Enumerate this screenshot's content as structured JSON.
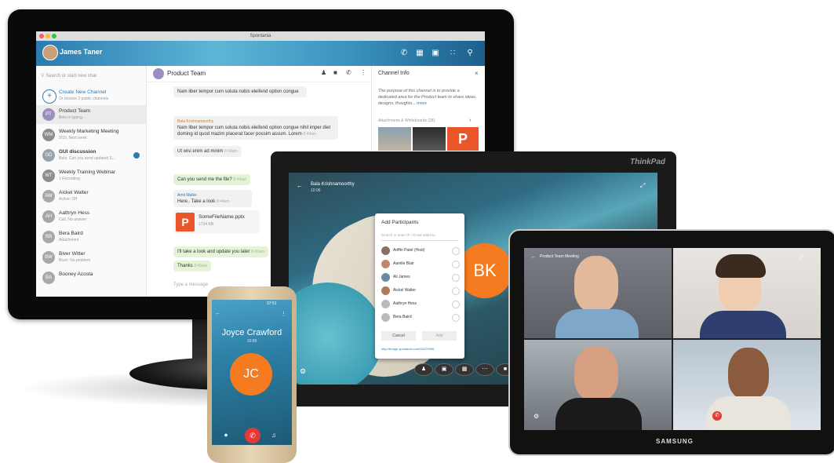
{
  "desktop": {
    "window_title": "Spontania",
    "user_name": "James Taner",
    "sidebar": {
      "search_placeholder": "Search or start new chat",
      "items": [
        {
          "title": "Create New Channel",
          "sub": "Or browse 2 public channels",
          "initials": "+"
        },
        {
          "title": "Product Team",
          "sub": "Bela is typing...",
          "initials": "PT"
        },
        {
          "title": "Weekly Marketing Meeting",
          "sub": "9/10, Next week",
          "initials": "WM"
        },
        {
          "title": "GUI discussion",
          "sub": "Bela: Can you send updated S...",
          "initials": "GD"
        },
        {
          "title": "Weekly Training Webinar",
          "sub": "1 Recording",
          "initials": "WT"
        },
        {
          "title": "Aickel Walter",
          "sub": "Active: Off",
          "initials": "AW"
        },
        {
          "title": "Aathryn Hess",
          "sub": "Call, No answer",
          "initials": "AH"
        },
        {
          "title": "Bera Baird",
          "sub": "Attachment",
          "initials": "BB"
        },
        {
          "title": "Biver Witter",
          "sub": "Biver: No problem",
          "initials": "BW"
        },
        {
          "title": "Booney Acosta",
          "sub": "",
          "initials": "BA"
        }
      ]
    },
    "chat": {
      "title": "Product Team",
      "messages": [
        {
          "sender": "",
          "text": "Nam liber tempor cum soluta nobis eleifend option congue",
          "time": ""
        },
        {
          "sender": "Bala Krishnamoorthy",
          "text": "Nam liber tempor cum soluta nobis eleifend option congue nihil imper diet doming id quod mazim placerat facer possim assum. Lorem",
          "time": "8:44am"
        },
        {
          "sender": "",
          "text": "Ut wisi enim ad minim",
          "time": "8:44am"
        },
        {
          "sender": "",
          "text": "Can you send me the file?",
          "time": "8:44am"
        },
        {
          "sender": "Amit Malke",
          "text": "Here.. Take a look",
          "time": "8:44am"
        },
        {
          "sender": "",
          "text": "I'll take a look and update you later",
          "time": "8:45am"
        },
        {
          "sender": "",
          "text": "Thanks",
          "time": "8:45am"
        }
      ],
      "file_name": "SomeFileName.pptx",
      "file_size": "1734 KB",
      "input_placeholder": "Type a message"
    },
    "channel_info": {
      "title": "Channel Info",
      "description": "The purpose of this channel is to provide a dedicated area for the Product team to share ideas, designs, thoughts...",
      "more": "more",
      "attachments_label": "Attachments & Whiteboards (28)"
    }
  },
  "thinkpad": {
    "brand": "ThinkPad",
    "caller": "Bala Krishnamoorthy",
    "duration": "10:06",
    "initials": "BK",
    "dialog": {
      "title": "Add Participants",
      "search_placeholder": "Search or enter IP / Email address",
      "participants": [
        "Ariffin Patel (Host)",
        "Aamlie Blair",
        "Ali James",
        "Aickel Walter",
        "Aathryn Hess",
        "Bera Baird"
      ],
      "cancel_label": "Cancel",
      "add_label": "Add",
      "link": "http://bridge.spontania.com/54479565"
    }
  },
  "samsung": {
    "brand": "SAMSUNG",
    "meeting_title": "Product Team Meeting"
  },
  "phone": {
    "caller": "Joyce Crawford",
    "duration": "10:06",
    "initials": "JC",
    "time": "07:51"
  },
  "colors": {
    "accent": "#2a7bb0",
    "avatar_orange": "#f47b20",
    "end_call": "#e53935"
  }
}
